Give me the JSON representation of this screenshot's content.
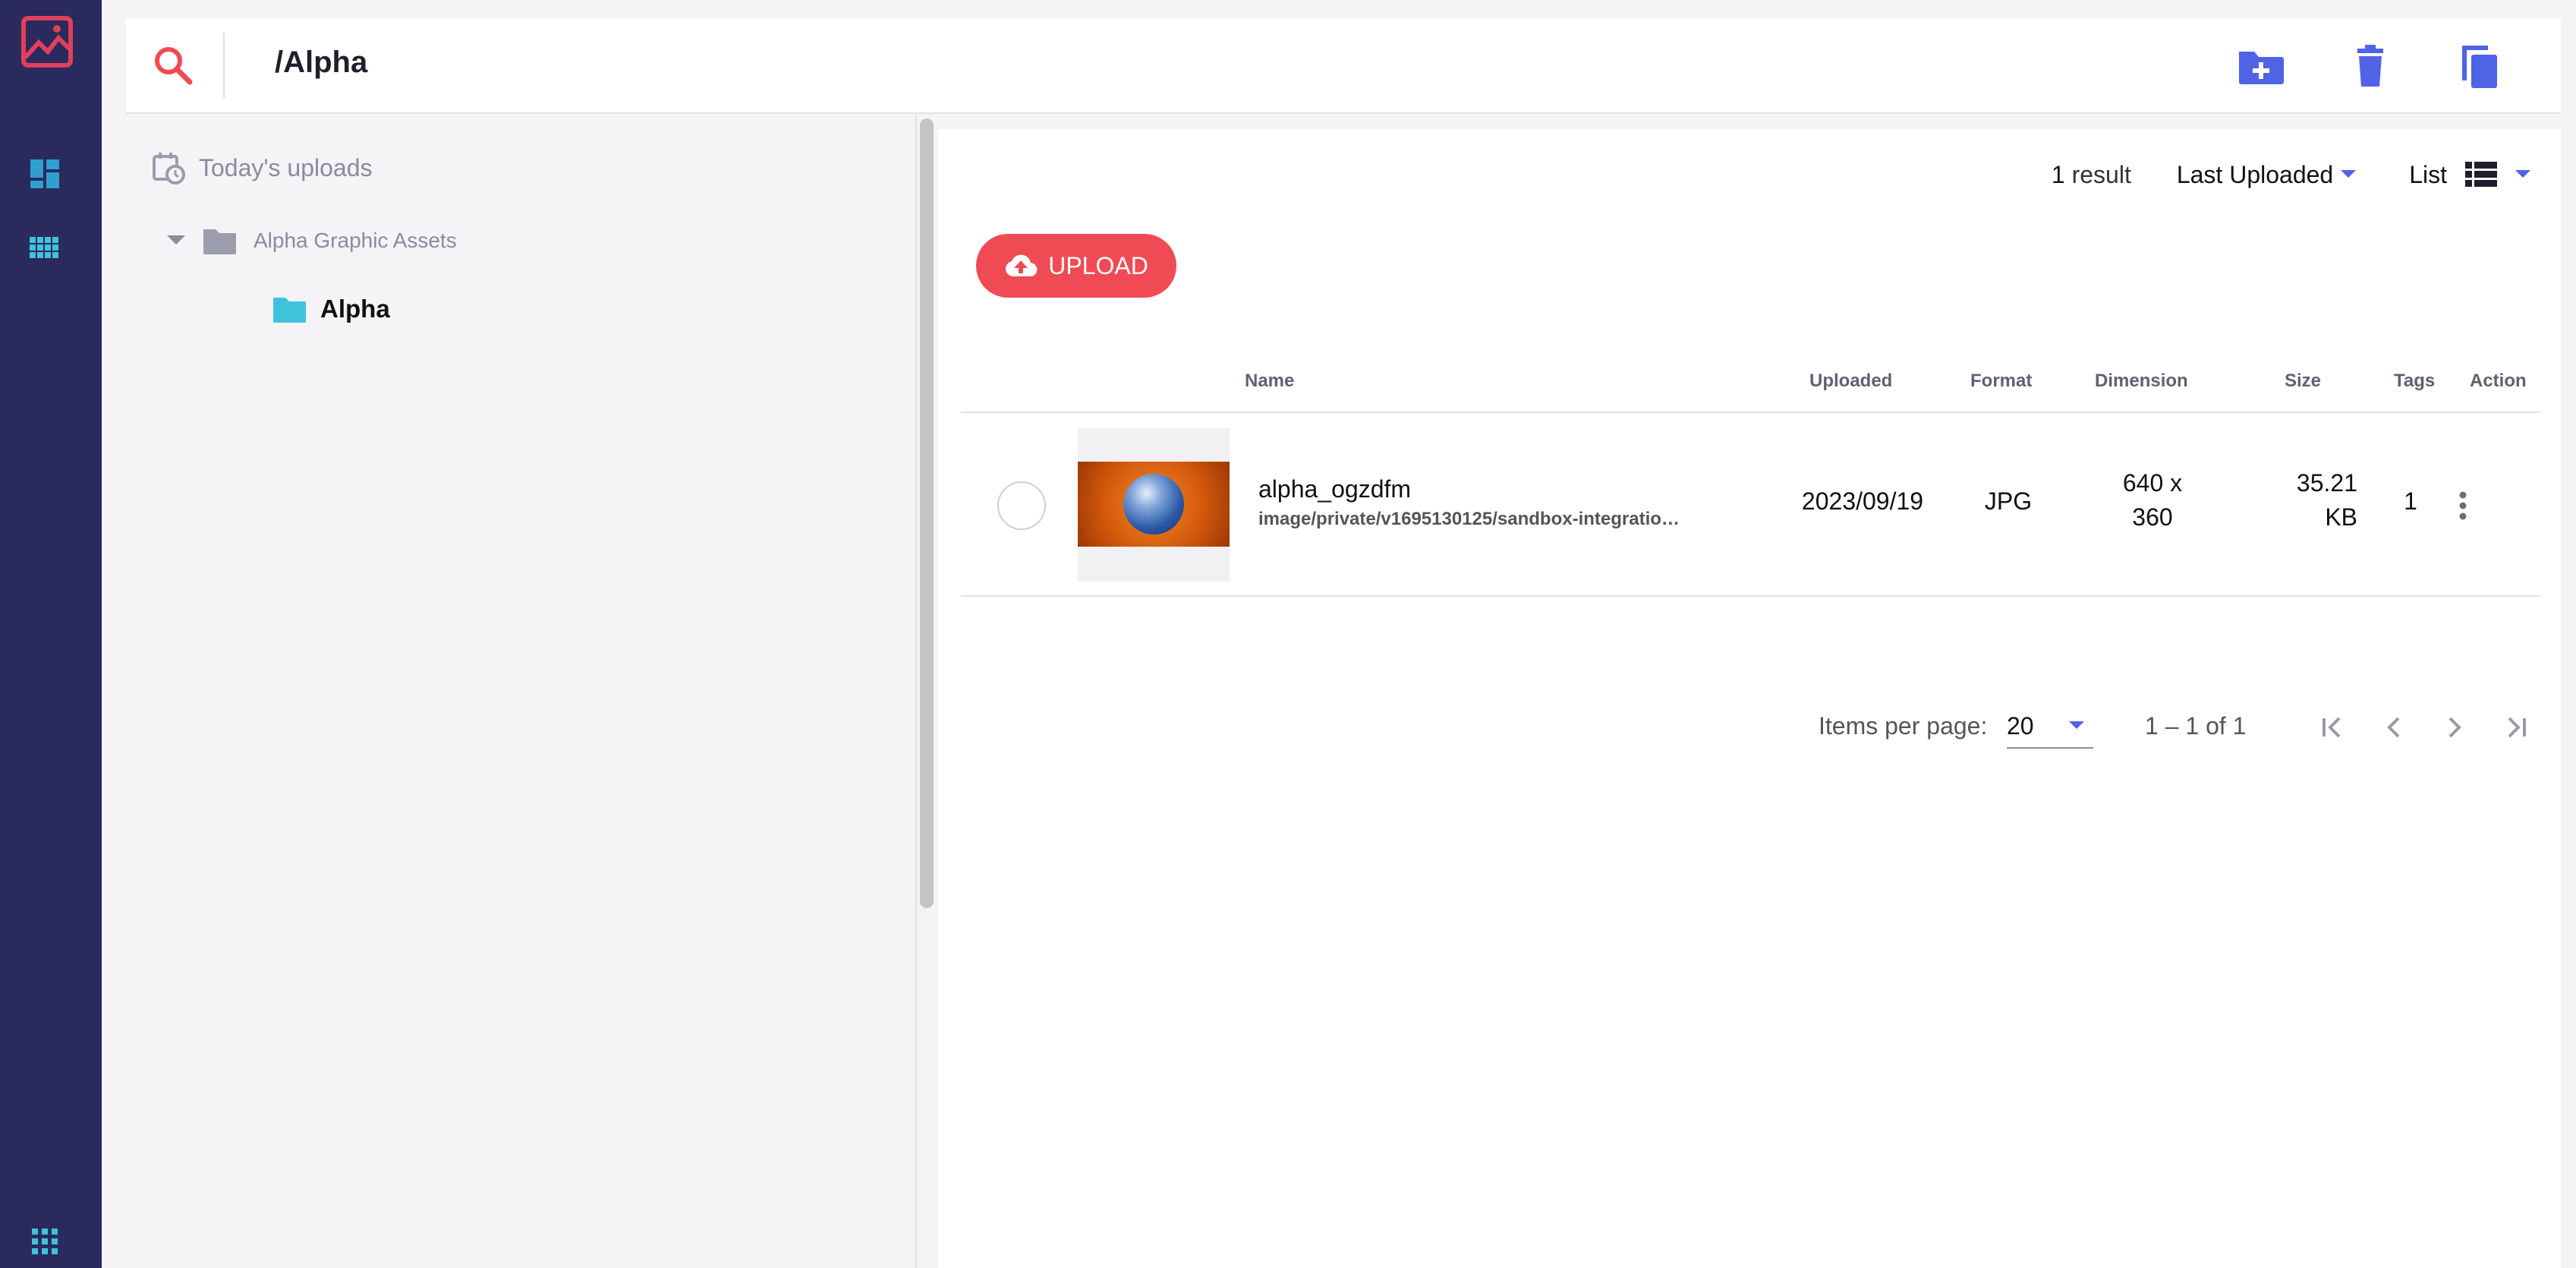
{
  "header": {
    "path": "/Alpha"
  },
  "tree": {
    "today_label": "Today's uploads",
    "root_folder": "Alpha Graphic Assets",
    "child_folder": "Alpha"
  },
  "toolbar": {
    "result_count": "1",
    "result_label": "result",
    "sort_label": "Last Uploaded",
    "view_label": "List"
  },
  "upload_label": "UPLOAD",
  "table": {
    "columns": {
      "name": "Name",
      "uploaded": "Uploaded",
      "format": "Format",
      "dimension": "Dimension",
      "size": "Size",
      "tags": "Tags",
      "action": "Action"
    },
    "rows": [
      {
        "name": "alpha_ogzdfm",
        "path": "image/private/v1695130125/sandbox-integration...",
        "uploaded": "2023/09/19",
        "format": "JPG",
        "dimension_line1": "640 x",
        "dimension_line2": "360",
        "size_line1": "35.21",
        "size_line2": "KB",
        "tags": "1"
      }
    ]
  },
  "pagination": {
    "items_per_page_label": "Items per page:",
    "items_per_page_value": "20",
    "range": "1 – 1 of 1"
  },
  "colors": {
    "rail": "#2a2a5e",
    "accent_red": "#f04b55",
    "accent_blue": "#4f63e6",
    "teal": "#3fc3dc",
    "folder_gray": "#9c9caf"
  },
  "icons": {
    "rail": [
      "logo-icon",
      "dashboard-icon",
      "grid-apps-icon",
      "apps-icon"
    ],
    "header_tools": [
      "new-folder-icon",
      "delete-icon",
      "copy-icon"
    ]
  }
}
